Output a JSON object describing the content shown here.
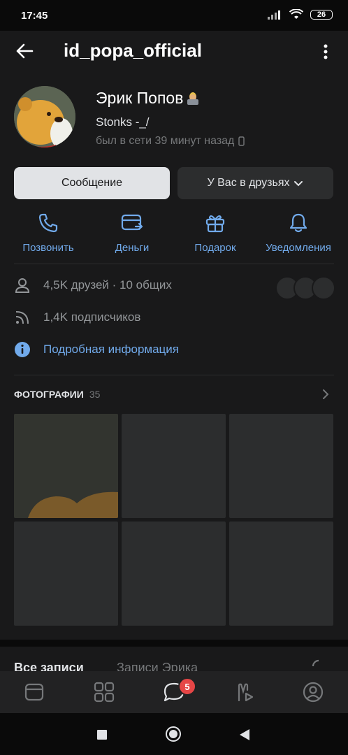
{
  "status_bar": {
    "time": "17:45",
    "battery": "26"
  },
  "header": {
    "username": "id_popa_official"
  },
  "profile": {
    "name": "Эрик Попов",
    "status": "Stonks -_/",
    "last_seen": "был в сети 39 минут назад"
  },
  "buttons": {
    "message": "Сообщение",
    "friends": "У Вас в друзьях"
  },
  "actions": [
    {
      "label": "Позвонить",
      "icon": "phone-icon"
    },
    {
      "label": "Деньги",
      "icon": "money-icon"
    },
    {
      "label": "Подарок",
      "icon": "gift-icon"
    },
    {
      "label": "Уведомления",
      "icon": "bell-icon"
    }
  ],
  "info": {
    "friends": "4,5K друзей · 10 общих",
    "subscribers": "1,4K подписчиков",
    "details": "Подробная информация"
  },
  "photos": {
    "title": "ФОТОГРАФИИ",
    "count": "35"
  },
  "tabs": {
    "all_posts": "Все записи",
    "user_posts": "Записи Эрика"
  },
  "bottom_nav": {
    "messages_badge": "5"
  },
  "colors": {
    "accent": "#71aaeb",
    "background": "#19191a",
    "badge": "#e64646"
  }
}
